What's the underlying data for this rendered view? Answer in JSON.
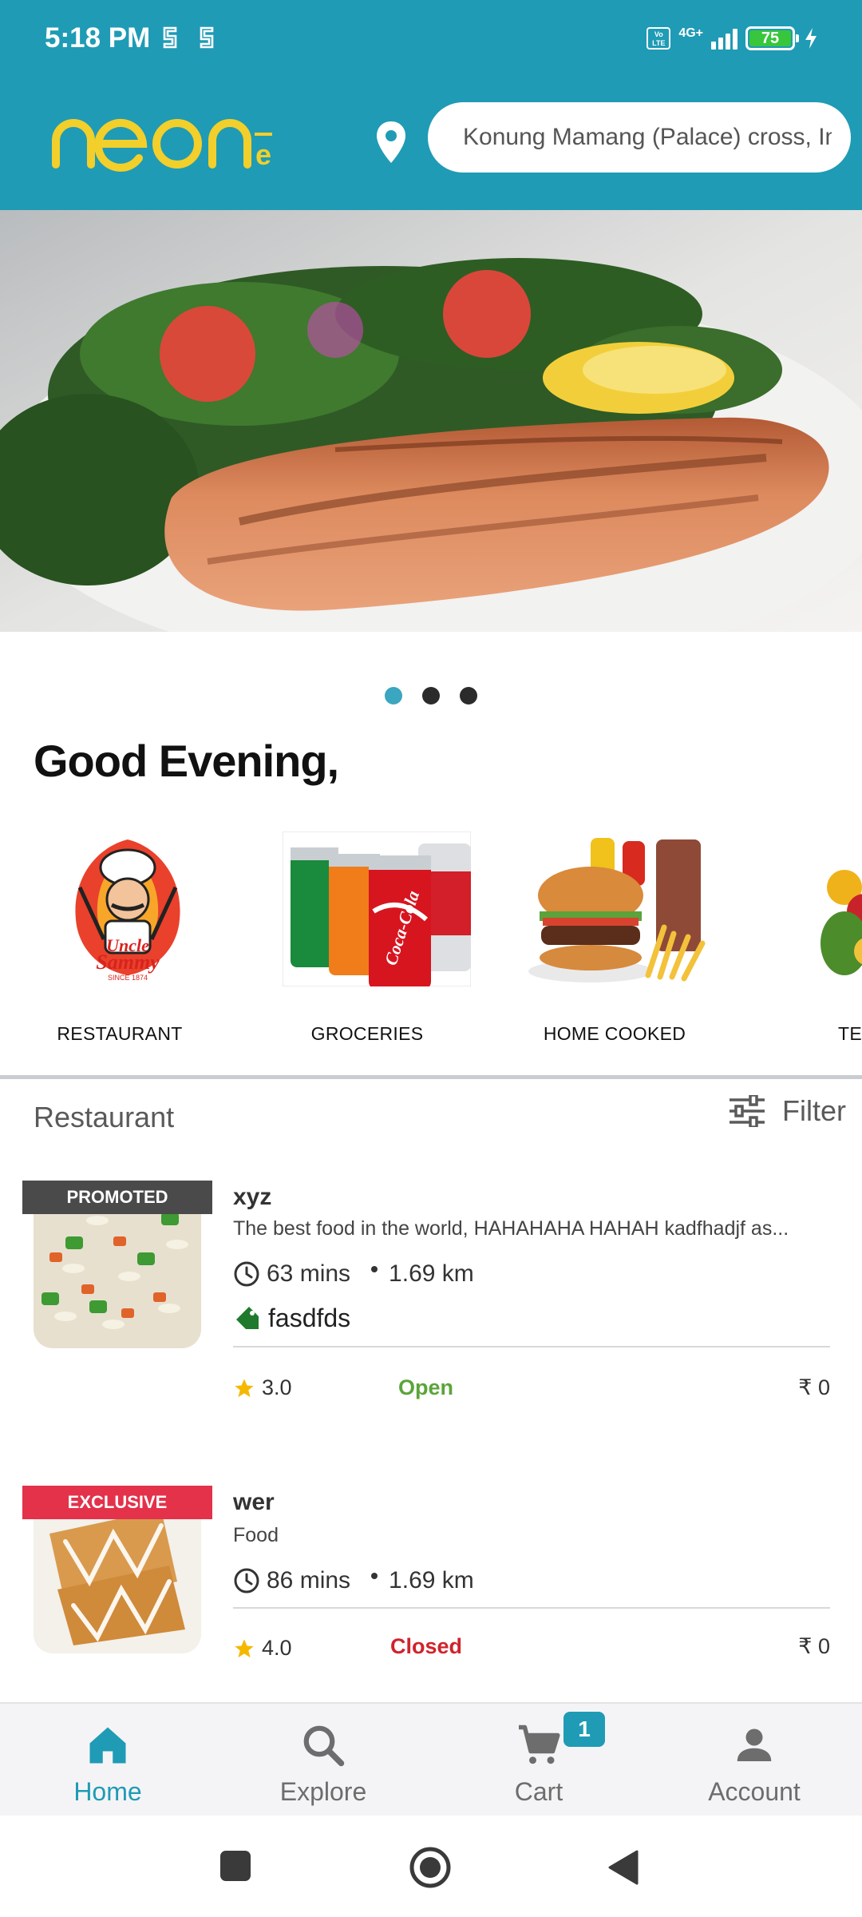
{
  "status_bar": {
    "time": "5:18 PM",
    "network": "4G+",
    "volte": "Vo LTE",
    "battery": "75"
  },
  "header": {
    "logo": "neone",
    "location_placeholder": "Konung Mamang (Palace) cross, Imphal"
  },
  "banner": {
    "dots": 3,
    "active_dot": 0
  },
  "greeting": "Good Evening,",
  "categories": [
    {
      "label": "RESTAURANT"
    },
    {
      "label": "GROCERIES"
    },
    {
      "label": "HOME COOKED"
    },
    {
      "label": "TEST"
    }
  ],
  "logo_text": {
    "line1": "Uncle",
    "line2": "Sammy",
    "since": "SINCE 1874"
  },
  "section": {
    "title": "Restaurant",
    "filter_label": "Filter"
  },
  "restaurants": [
    {
      "ribbon": "PROMOTED",
      "name": "xyz",
      "description": "The best food in the world, HAHAHAHA HAHAH kadfhadjf as...",
      "time": "63 mins",
      "distance": "1.69 km",
      "tag": "fasdfds",
      "rating": "3.0",
      "status": "Open",
      "price": "₹ 0"
    },
    {
      "ribbon": "EXCLUSIVE",
      "name": "wer",
      "description": "Food",
      "time": "86 mins",
      "distance": "1.69 km",
      "rating": "4.0",
      "status": "Closed",
      "price": "₹ 0"
    }
  ],
  "bottom_nav": [
    {
      "label": "Home",
      "icon": "home-icon"
    },
    {
      "label": "Explore",
      "icon": "search-icon"
    },
    {
      "label": "Cart",
      "icon": "cart-icon",
      "badge": "1"
    },
    {
      "label": "Account",
      "icon": "account-icon"
    }
  ],
  "colors": {
    "primary": "#1f9bb5",
    "logo": "#f2cf2b",
    "open": "#5ba43a",
    "closed": "#d0232c",
    "star": "#f5b800"
  }
}
